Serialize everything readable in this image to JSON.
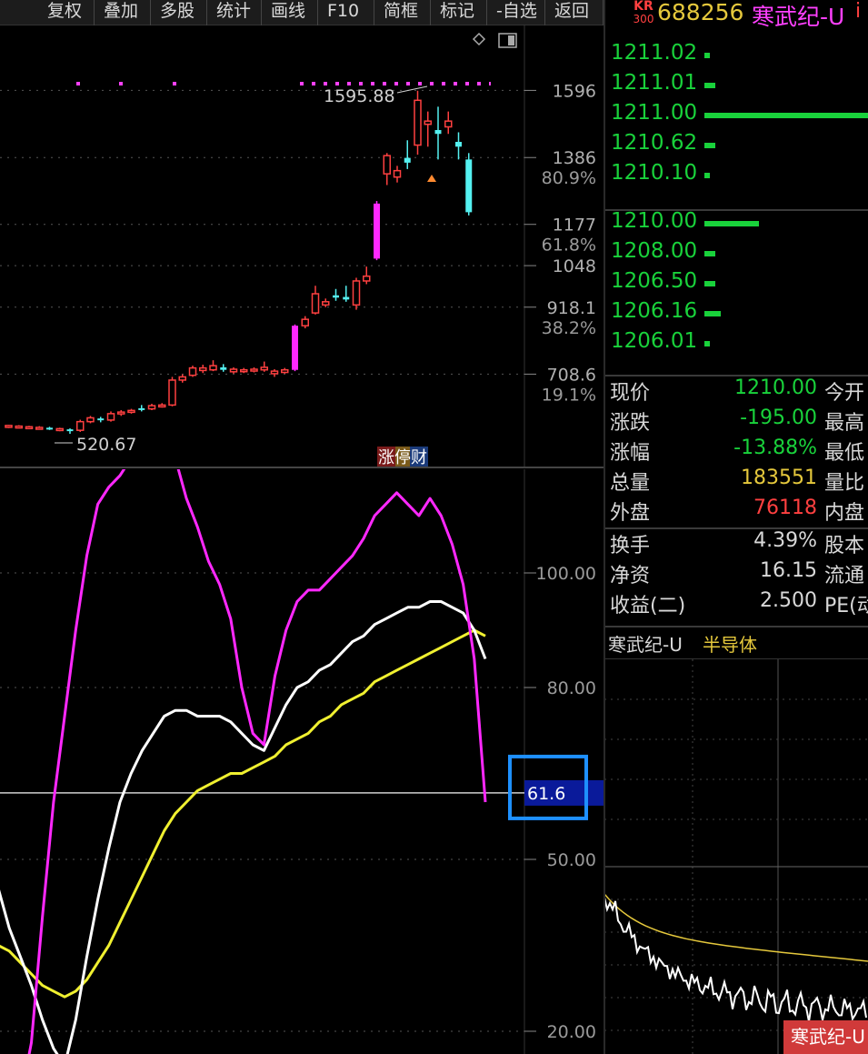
{
  "toolbar": {
    "buttons": [
      "复权",
      "叠加",
      "多股",
      "统计",
      "画线",
      "F10",
      "简框",
      "标记",
      "-自选",
      "返回"
    ]
  },
  "header": {
    "badge_top": "KR",
    "badge_bottom": "300",
    "code": "688256",
    "name": "寒武纪-U",
    "info_icon": "i"
  },
  "main_chart": {
    "high_label": "1595.88",
    "low_label": "520.67",
    "tag_left": "涨",
    "tag_mid": "停",
    "tag_right": "财",
    "price_axis": [
      "1596",
      "1386",
      "1177",
      "1048",
      "918.1",
      "708.6"
    ],
    "pct_axis": [
      "80.9%",
      "61.8%",
      "38.2%",
      "19.1%"
    ],
    "candles": [
      {
        "o": 548,
        "c": 544,
        "h": 550,
        "l": 540,
        "col": "red"
      },
      {
        "o": 546,
        "c": 543,
        "h": 549,
        "l": 540,
        "col": "red"
      },
      {
        "o": 544,
        "c": 541,
        "h": 547,
        "l": 538,
        "col": "red"
      },
      {
        "o": 542,
        "c": 540,
        "h": 546,
        "l": 536,
        "col": "red"
      },
      {
        "o": 541,
        "c": 538,
        "h": 544,
        "l": 534,
        "col": "cyan"
      },
      {
        "o": 538,
        "c": 536,
        "h": 541,
        "l": 530,
        "col": "red"
      },
      {
        "o": 536,
        "c": 533,
        "h": 539,
        "l": 522,
        "col": "cyan"
      },
      {
        "o": 533,
        "c": 560,
        "h": 566,
        "l": 528,
        "col": "red"
      },
      {
        "o": 560,
        "c": 572,
        "h": 578,
        "l": 555,
        "col": "red"
      },
      {
        "o": 570,
        "c": 565,
        "h": 575,
        "l": 558,
        "col": "cyan"
      },
      {
        "o": 565,
        "c": 585,
        "h": 592,
        "l": 560,
        "col": "red"
      },
      {
        "o": 585,
        "c": 590,
        "h": 596,
        "l": 578,
        "col": "red"
      },
      {
        "o": 590,
        "c": 595,
        "h": 600,
        "l": 585,
        "col": "red"
      },
      {
        "o": 598,
        "c": 602,
        "h": 612,
        "l": 592,
        "col": "cyan"
      },
      {
        "o": 600,
        "c": 610,
        "h": 616,
        "l": 596,
        "col": "red"
      },
      {
        "o": 608,
        "c": 612,
        "h": 618,
        "l": 604,
        "col": "red"
      },
      {
        "o": 612,
        "c": 690,
        "h": 700,
        "l": 608,
        "col": "red"
      },
      {
        "o": 690,
        "c": 700,
        "h": 708,
        "l": 682,
        "col": "red"
      },
      {
        "o": 705,
        "c": 728,
        "h": 735,
        "l": 700,
        "col": "red"
      },
      {
        "o": 728,
        "c": 720,
        "h": 738,
        "l": 712,
        "col": "red"
      },
      {
        "o": 722,
        "c": 735,
        "h": 752,
        "l": 718,
        "col": "red"
      },
      {
        "o": 730,
        "c": 722,
        "h": 740,
        "l": 716,
        "col": "cyan"
      },
      {
        "o": 724,
        "c": 716,
        "h": 730,
        "l": 710,
        "col": "red"
      },
      {
        "o": 718,
        "c": 722,
        "h": 728,
        "l": 712,
        "col": "red"
      },
      {
        "o": 720,
        "c": 724,
        "h": 730,
        "l": 714,
        "col": "red"
      },
      {
        "o": 722,
        "c": 730,
        "h": 748,
        "l": 716,
        "col": "red"
      },
      {
        "o": 718,
        "c": 710,
        "h": 724,
        "l": 700,
        "col": "red"
      },
      {
        "o": 714,
        "c": 722,
        "h": 728,
        "l": 710,
        "col": "red"
      },
      {
        "o": 722,
        "c": 860,
        "h": 864,
        "l": 718,
        "col": "magenta"
      },
      {
        "o": 860,
        "c": 880,
        "h": 890,
        "l": 852,
        "col": "red"
      },
      {
        "o": 900,
        "c": 960,
        "h": 985,
        "l": 895,
        "col": "red"
      },
      {
        "o": 935,
        "c": 925,
        "h": 945,
        "l": 918,
        "col": "red"
      },
      {
        "o": 955,
        "c": 948,
        "h": 975,
        "l": 938,
        "col": "cyan"
      },
      {
        "o": 950,
        "c": 942,
        "h": 985,
        "l": 935,
        "col": "cyan"
      },
      {
        "o": 925,
        "c": 1000,
        "h": 1010,
        "l": 910,
        "col": "red"
      },
      {
        "o": 1000,
        "c": 1015,
        "h": 1045,
        "l": 990,
        "col": "red"
      },
      {
        "o": 1070,
        "c": 1242,
        "h": 1250,
        "l": 1065,
        "col": "magenta"
      },
      {
        "o": 1335,
        "c": 1392,
        "h": 1400,
        "l": 1300,
        "col": "red"
      },
      {
        "o": 1325,
        "c": 1345,
        "h": 1360,
        "l": 1308,
        "col": "red"
      },
      {
        "o": 1370,
        "c": 1385,
        "h": 1440,
        "l": 1350,
        "col": "cyan"
      },
      {
        "o": 1425,
        "c": 1565,
        "h": 1595,
        "l": 1395,
        "col": "red"
      },
      {
        "o": 1490,
        "c": 1500,
        "h": 1530,
        "l": 1420,
        "col": "red"
      },
      {
        "o": 1460,
        "c": 1472,
        "h": 1545,
        "l": 1380,
        "col": "cyan"
      },
      {
        "o": 1500,
        "c": 1482,
        "h": 1530,
        "l": 1460,
        "col": "red"
      },
      {
        "o": 1435,
        "c": 1420,
        "h": 1465,
        "l": 1380,
        "col": "cyan"
      },
      {
        "o": 1380,
        "c": 1215,
        "h": 1400,
        "l": 1205,
        "col": "cyan"
      }
    ]
  },
  "indicator": {
    "axis": [
      "100.00",
      "80.00",
      "50.00",
      "20.00"
    ],
    "current_value": "61.6",
    "magenta": [
      10,
      9,
      8,
      18,
      40,
      60,
      75,
      90,
      103,
      112,
      115,
      117,
      120,
      121,
      123,
      121,
      120,
      113,
      108,
      102,
      98,
      92,
      80,
      72,
      70,
      82,
      90,
      95,
      97,
      97,
      99,
      101,
      103,
      106,
      110,
      112,
      114,
      112,
      110,
      113,
      110,
      105,
      98,
      85,
      60
    ],
    "white": [
      45,
      38,
      33,
      28,
      22,
      17,
      14,
      22,
      33,
      43,
      52,
      60,
      65,
      69,
      72,
      75,
      76,
      76,
      75,
      75,
      75,
      74,
      72,
      70,
      69,
      73,
      77,
      80,
      81,
      83,
      84,
      86,
      88,
      89,
      91,
      92,
      93,
      94,
      94,
      95,
      95,
      94,
      93,
      90,
      85
    ],
    "yellow": [
      35,
      34,
      32,
      30,
      28,
      27,
      26,
      27,
      29,
      32,
      35,
      39,
      43,
      47,
      51,
      55,
      58,
      60,
      62,
      63,
      64,
      65,
      65,
      66,
      67,
      68,
      70,
      71,
      72,
      74,
      75,
      77,
      78,
      79,
      81,
      82,
      83,
      84,
      85,
      86,
      87,
      88,
      89,
      90,
      89
    ]
  },
  "order_book": {
    "asks": [
      {
        "price": "1211.02",
        "bar": 6
      },
      {
        "price": "1211.01",
        "bar": 12
      },
      {
        "price": "1211.00",
        "bar": 181
      },
      {
        "price": "1210.62",
        "bar": 12
      },
      {
        "price": "1210.10",
        "bar": 6
      }
    ],
    "bids": [
      {
        "price": "1210.00",
        "bar": 60
      },
      {
        "price": "1208.00",
        "bar": 12
      },
      {
        "price": "1206.50",
        "bar": 12
      },
      {
        "price": "1206.16",
        "bar": 18
      },
      {
        "price": "1206.01",
        "bar": 6
      }
    ],
    "bar_color": "#19d23b"
  },
  "quote": {
    "rows": [
      {
        "label": "现价",
        "value": "1210.00",
        "color": "#19d23b",
        "label2": "今开"
      },
      {
        "label": "涨跌",
        "value": "-195.00",
        "color": "#19d23b",
        "label2": "最高"
      },
      {
        "label": "涨幅",
        "value": "-13.88%",
        "color": "#19d23b",
        "label2": "最低"
      },
      {
        "label": "总量",
        "value": "183551",
        "color": "#e5c83c",
        "label2": "量比"
      },
      {
        "label": "外盘",
        "value": "76118",
        "color": "#ff4040",
        "label2": "内盘"
      }
    ],
    "rows2": [
      {
        "label": "换手",
        "value": "4.39%",
        "label2": "股本"
      },
      {
        "label": "净资",
        "value": "16.15",
        "label2": "流通"
      },
      {
        "label": "收益(二)",
        "value": "2.500",
        "label2": "PE(动"
      }
    ]
  },
  "sector": {
    "stock": "寒武纪-U",
    "industry": "半导体",
    "tag": "寒武纪-U"
  }
}
